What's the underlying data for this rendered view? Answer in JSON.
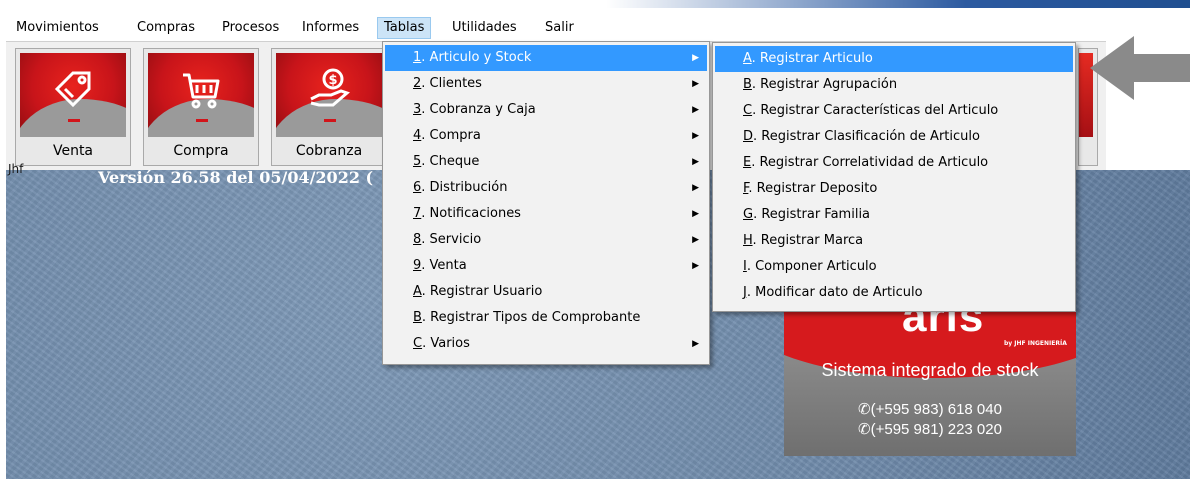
{
  "menubar": {
    "items": [
      "Movimientos",
      "Compras",
      "Procesos",
      "Informes",
      "Tablas",
      "Utilidades",
      "Salir"
    ],
    "active": "Tablas"
  },
  "toolbar": {
    "buttons": [
      {
        "label": "Venta",
        "icon": "tag-icon"
      },
      {
        "label": "Compra",
        "icon": "cart-icon"
      },
      {
        "label": "Cobranza",
        "icon": "coin-hand-icon"
      }
    ]
  },
  "status": {
    "user": "Jhf",
    "version": "Versión 26.58 del 05/04/2022  ("
  },
  "tablas_menu": {
    "items": [
      {
        "key": "1",
        "rest": ". Articulo y Stock",
        "submenu": true
      },
      {
        "key": "2",
        "rest": ". Clientes",
        "submenu": true
      },
      {
        "key": "3",
        "rest": ". Cobranza y Caja",
        "submenu": true
      },
      {
        "key": "4",
        "rest": ". Compra",
        "submenu": true
      },
      {
        "key": "5",
        "rest": ". Cheque",
        "submenu": true
      },
      {
        "key": "6",
        "rest": ". Distribución",
        "submenu": true
      },
      {
        "key": "7",
        "rest": ". Notificaciones",
        "submenu": true
      },
      {
        "key": "8",
        "rest": ". Servicio",
        "submenu": true
      },
      {
        "key": "9",
        "rest": ". Venta",
        "submenu": true
      },
      {
        "key": "A",
        "rest": ". Registrar Usuario",
        "submenu": false
      },
      {
        "key": "B",
        "rest": ". Registrar Tipos de Comprobante",
        "submenu": false
      },
      {
        "key": "C",
        "rest": ". Varios",
        "submenu": true
      }
    ]
  },
  "articulo_submenu": {
    "items": [
      {
        "key": "A",
        "rest": ". Registrar Articulo"
      },
      {
        "key": "B",
        "rest": ". Registrar Agrupación"
      },
      {
        "key": "C",
        "rest": ". Registrar Características del Articulo"
      },
      {
        "key": "D",
        "rest": ". Registrar Clasificación de Articulo"
      },
      {
        "key": "E",
        "rest": ". Registrar Correlatividad de Articulo"
      },
      {
        "key": "F",
        "rest": ". Registrar Deposito"
      },
      {
        "key": "G",
        "rest": ". Registrar Familia"
      },
      {
        "key": "H",
        "rest": ". Registrar Marca"
      },
      {
        "key": "I",
        "rest": ". Componer Articulo"
      },
      {
        "key": "J",
        "rest": ". Modificar dato de Articulo"
      }
    ]
  },
  "promo": {
    "brand": "aris",
    "brand_sub": "by JHF INGENIERÍA",
    "tagline": "Sistema integrado de stock",
    "phone1": "✆(+595 983) 618 040",
    "phone2": "✆(+595 981) 223 020"
  },
  "colors": {
    "menu_highlight": "#3399ff",
    "workspace": "#7390b0",
    "brand_red": "#d61a1d"
  }
}
